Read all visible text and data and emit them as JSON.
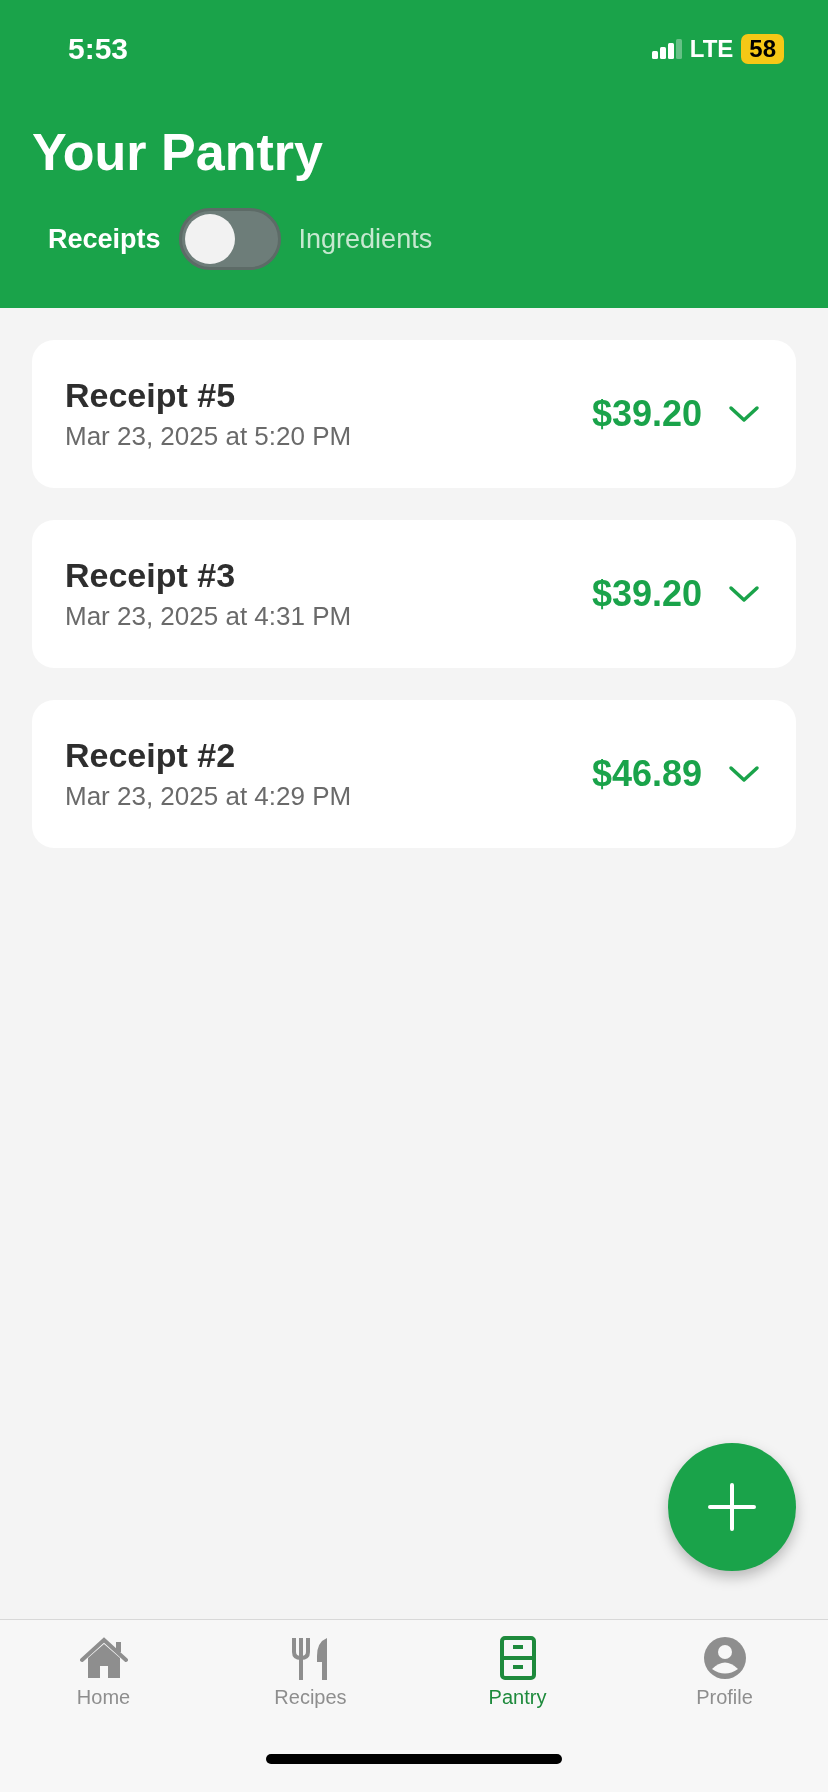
{
  "status_bar": {
    "time": "5:53",
    "network": "LTE",
    "battery": "58"
  },
  "header": {
    "title": "Your Pantry",
    "toggle": {
      "left_label": "Receipts",
      "right_label": "Ingredients",
      "on": false
    }
  },
  "receipts": [
    {
      "title": "Receipt #5",
      "date": "Mar 23, 2025 at 5:20 PM",
      "total": "$39.20",
      "expanded": false
    },
    {
      "title": "Receipt #3",
      "date": "Mar 23, 2025 at 4:31 PM",
      "total": "$39.20",
      "expanded": false
    },
    {
      "title": "Receipt #2",
      "date": "Mar 23, 2025 at 4:29 PM",
      "total": "$46.89",
      "expanded": false
    }
  ],
  "tabs": [
    {
      "label": "Home",
      "kind": "home",
      "selected": false
    },
    {
      "label": "Recipes",
      "kind": "recipes",
      "selected": false
    },
    {
      "label": "Pantry",
      "kind": "pantry",
      "selected": true
    },
    {
      "label": "Profile",
      "kind": "profile",
      "selected": false
    }
  ]
}
